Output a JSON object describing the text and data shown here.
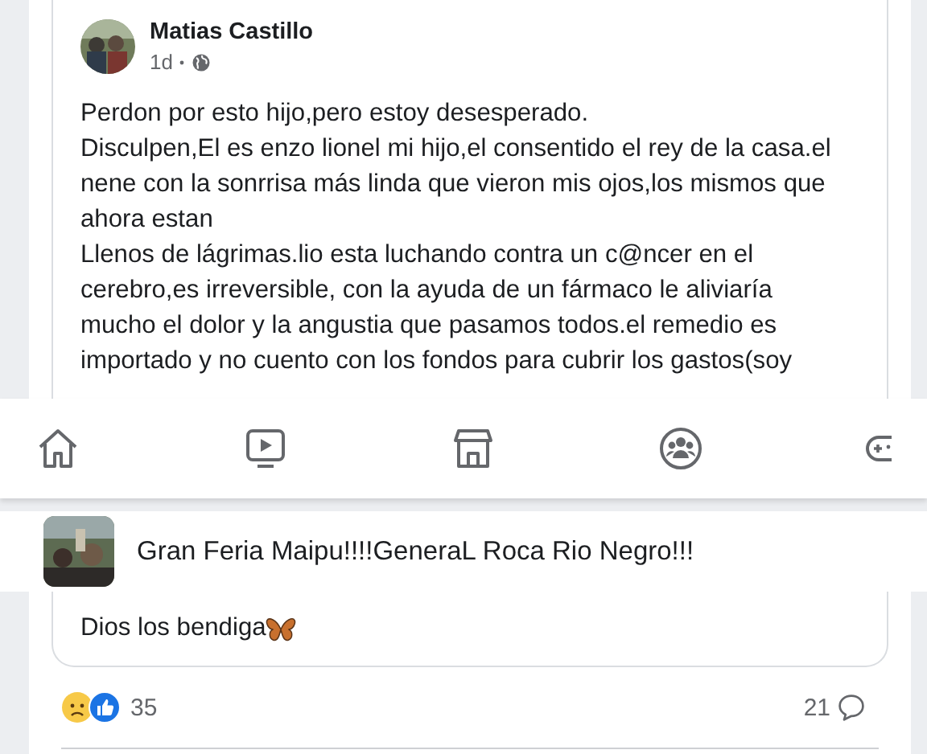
{
  "post": {
    "author": "Matias Castillo",
    "time": "1d",
    "paragraphs": [
      "Perdon por esto hijo,pero estoy desesperado.",
      "Disculpen,El es enzo lionel mi hijo,el consentido el rey de la casa.el nene con la sonrrisa más linda que vieron mis ojos,los mismos que ahora estan",
      "Llenos de lágrimas.lio esta luchando contra un c@ncer en el cerebro,es irreversible, con la ayuda de un fármaco le aliviaría mucho el dolor y la angustia que pasamos todos.el remedio es importado y no cuento con los fondos para cubrir los gastos(soy"
    ]
  },
  "group_banner": {
    "title": "Gran Feria Maipu!!!!GeneraL Roca Rio Negro!!!"
  },
  "post_end": {
    "closing": "Dios los bendiga",
    "reaction_count": "35",
    "comment_count": "21"
  }
}
